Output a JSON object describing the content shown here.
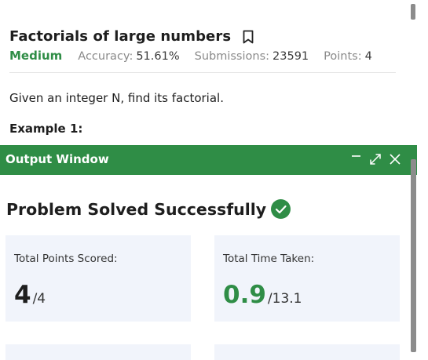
{
  "problem": {
    "title": "Factorials of large numbers",
    "difficulty": "Medium",
    "accuracy_label": "Accuracy:",
    "accuracy_value": "51.61%",
    "submissions_label": "Submissions:",
    "submissions_value": "23591",
    "points_label": "Points:",
    "points_value": "4",
    "description": "Given an integer N, find its factorial.",
    "example_heading": "Example 1:"
  },
  "output_window": {
    "title": "Output Window",
    "status": "Problem Solved Successfully",
    "cards": [
      {
        "label": "Total Points Scored:",
        "value": "4",
        "total": "/4"
      },
      {
        "label": "Total Time Taken:",
        "value": "0.9",
        "total": "/13.1"
      }
    ]
  },
  "colors": {
    "accent": "#2f8d46",
    "card_bg": "#f1f4fb"
  },
  "icons": [
    "bookmark-icon",
    "minimize-icon",
    "expand-icon",
    "close-icon",
    "check-circle-icon"
  ]
}
